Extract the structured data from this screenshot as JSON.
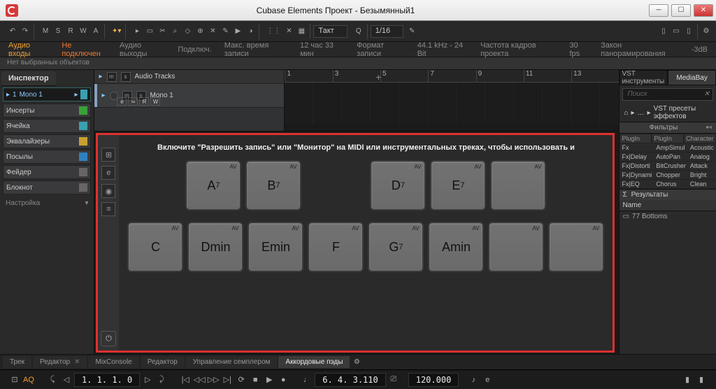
{
  "window": {
    "title": "Cubase Elements Проект - Безымянный1"
  },
  "toolbar": {
    "msrwa": [
      "M",
      "S",
      "R",
      "W",
      "A"
    ],
    "grid_label": "Такт",
    "quantize_label": "1/16"
  },
  "infobar": {
    "audio_in": "Аудио входы",
    "not_connected": "Не подключен",
    "audio_out": "Аудио выходы",
    "connected": "Подключ.",
    "max_rec": "Макс. время записи",
    "max_rec_val": "12 час 33 мин",
    "rec_fmt": "Формат записи",
    "rec_fmt_val": "44.1 kHz - 24 Bit",
    "frame_rate": "Частота кадров проекта",
    "frame_rate_val": "30 fps",
    "pan_law": "Закон панорамирования",
    "pan_law_val": "-3dB"
  },
  "status": {
    "no_sel": "Нет выбранных объектов"
  },
  "inspector": {
    "title": "Инспектор",
    "track": {
      "num": "1",
      "name": "Mono 1"
    },
    "sections": [
      "Инсерты",
      "Ячейка",
      "Эквалайзеры",
      "Посылы",
      "Фейдер",
      "Блокнот"
    ],
    "settings": "Настройка"
  },
  "tracks": {
    "header": "Audio Tracks",
    "row": "Mono 1",
    "extra_btns": [
      "e",
      "∞",
      "R",
      "W"
    ]
  },
  "ruler": [
    "1",
    "3",
    "5",
    "7",
    "9",
    "11",
    "13"
  ],
  "chord": {
    "hint": "Включите \"Разрешить запись\" или \"Монитор\" на MIDI или инструментальных треках, чтобы использовать и",
    "row1": [
      "A<sup>7</sup>",
      "B<sup>7</sup>",
      "",
      "D<sup>7</sup>",
      "E<sup>7</sup>",
      ""
    ],
    "row2": [
      "C",
      "Dmin",
      "Emin",
      "F",
      "G<sup>7</sup>",
      "Amin",
      "",
      ""
    ]
  },
  "right": {
    "tabs": [
      "VST инструменты",
      "MediaBay"
    ],
    "search_ph": "Поиск",
    "breadcrumb": "VST пресеты эффектов",
    "filters_title": "Фильтры",
    "col_heads": [
      "PlugIn Cate",
      "PlugIn Nam",
      "Character"
    ],
    "col1": [
      "Fx",
      "Fx|Delay",
      "Fx|Distorti",
      "Fx|Dynami",
      "Fx|EQ"
    ],
    "col2": [
      "AmpSimul",
      "AutoPan",
      "BitCrusher",
      "Chopper",
      "Chorus"
    ],
    "col3": [
      "Acoustic",
      "Analog",
      "Attack",
      "Bright",
      "Clean"
    ],
    "results": "Результаты",
    "name_hdr": "Name",
    "item": "77 Bottoms"
  },
  "bottom": {
    "tabs": [
      "Трек",
      "Редактор",
      "MixConsole",
      "Редактор",
      "Управление семплером",
      "Аккордовые пэды"
    ]
  },
  "transport": {
    "pos1": "1. 1. 1. 0",
    "pos2": "6. 4. 3.110",
    "tempo": "120.000"
  }
}
